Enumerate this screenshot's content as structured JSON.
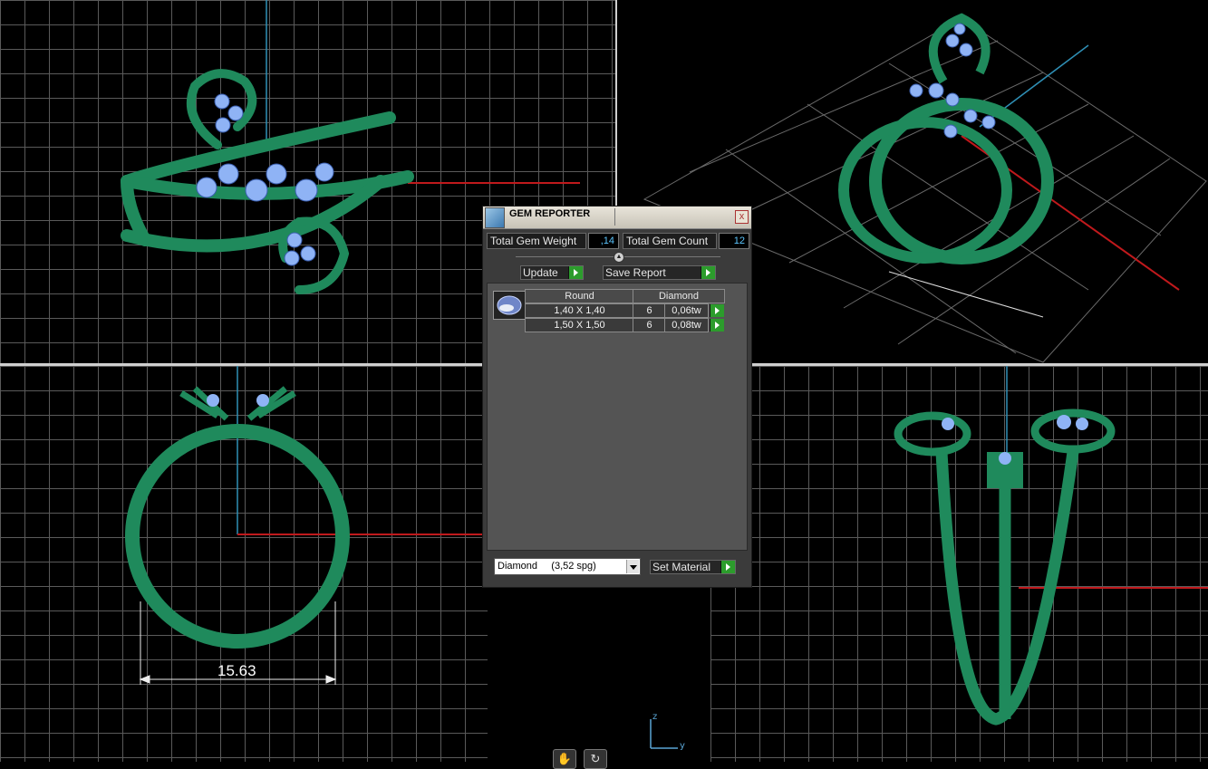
{
  "dialog": {
    "title": "GEM REPORTER",
    "close_label": "x",
    "total_weight_label": "Total Gem Weight",
    "total_weight_value": ",14",
    "total_count_label": "Total Gem Count",
    "total_count_value": "12",
    "update_label": "Update",
    "save_report_label": "Save Report",
    "table": {
      "shape": "Round",
      "material": "Diamond",
      "rows": [
        {
          "size": "1,40 X 1,40",
          "count": "6",
          "weight": "0,06tw"
        },
        {
          "size": "1,50 X 1,50",
          "count": "6",
          "weight": "0,08tw"
        }
      ]
    },
    "material_select": "Diamond     (3,52 spg)",
    "set_material_label": "Set Material"
  },
  "viewports": {
    "dimension_label": "15.63",
    "axis_z": "z",
    "axis_y": "y"
  },
  "colors": {
    "metal": "#1f8a5c",
    "gem": "#8fb3f5",
    "axis_red": "#c0191c",
    "axis_blue": "#2f8fb5",
    "action_green": "#2c9c2c"
  }
}
